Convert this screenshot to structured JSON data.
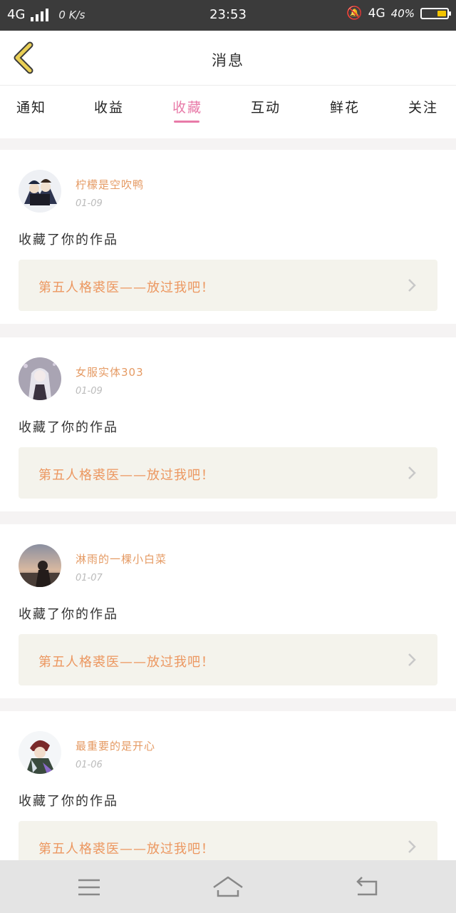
{
  "status": {
    "network": "4G",
    "speed": "0 K/s",
    "time": "23:53",
    "network_right": "4G",
    "battery": "40%"
  },
  "header": {
    "title": "消息"
  },
  "tabs": [
    "通知",
    "收益",
    "收藏",
    "互动",
    "鲜花",
    "关注"
  ],
  "active_tab": "收藏",
  "items": [
    {
      "username": "柠檬是空吹鸭",
      "date": "01-09",
      "action": "收藏了你的作品",
      "work": "第五人格裘医——放过我吧！"
    },
    {
      "username": "女服实体303",
      "date": "01-09",
      "action": "收藏了你的作品",
      "work": "第五人格裘医——放过我吧！"
    },
    {
      "username": "淋雨的一棵小白菜",
      "date": "01-07",
      "action": "收藏了你的作品",
      "work": "第五人格裘医——放过我吧！"
    },
    {
      "username": "最重要的是开心",
      "date": "01-06",
      "action": "收藏了你的作品",
      "work": "第五人格裘医——放过我吧！"
    }
  ],
  "colors": {
    "accent": "#e87aa8",
    "work_text": "#ec9760",
    "username": "#e59a63",
    "back_icon": "#e9cf55"
  },
  "icons": {
    "back": "chevron-left-icon",
    "nav_menu": "menu-icon",
    "nav_home": "home-icon",
    "nav_back": "return-icon"
  }
}
